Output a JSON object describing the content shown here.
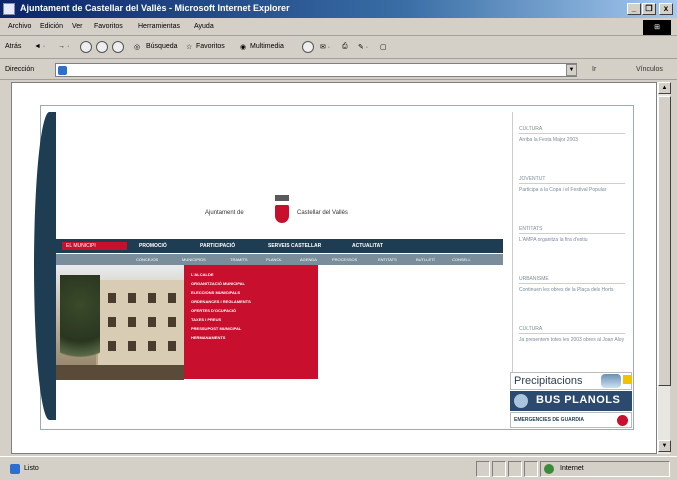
{
  "window": {
    "title": "Ajuntament de Castellar del Vallès - Microsoft Internet Explorer",
    "minimize": "_",
    "maximize": "❐",
    "close": "x"
  },
  "menubar": {
    "items": [
      "Archivo",
      "Edición",
      "Ver",
      "Favoritos",
      "Herramientas",
      "Ayuda"
    ]
  },
  "toolbar": {
    "back": "Atrás",
    "search": "Búsqueda",
    "favorites": "Favoritos",
    "multimedia": "Multimedia"
  },
  "addressbar": {
    "label": "Dirección",
    "value": "",
    "go": "Ir",
    "links": "Vínculos"
  },
  "status": {
    "text": "Listo",
    "zone": "Internet"
  },
  "site": {
    "logo_left": "Ajuntament de",
    "logo_right": "Castellar del Vallès",
    "nav": {
      "selected": "EL MUNICIPI",
      "items": [
        "PROMOCIÓ",
        "PARTICIPACIÓ",
        "SERVEIS CASTELLAR",
        "ACTUALITAT"
      ]
    },
    "subnav": [
      "CONCEJOS",
      "MUNICIPIOS",
      "TRAMITS",
      "PLANOL",
      "AGENDA",
      "PROCESSOS",
      "ENTITATS",
      "BUTLLETÍ",
      "CONSELL"
    ],
    "dropdown": [
      "L'ALCALDE",
      "ORGANITZACIÓ MUNICIPAL",
      "ELECCIONS MUNICIPALS",
      "ORDENANCES I REGLAMENTS",
      "OFERTES D'OCUPACIÓ",
      "TAXES I PREUS",
      "PRESSUPOST MUNICIPAL",
      "HERMANAMENTS"
    ],
    "sidebar": [
      {
        "title": "CULTURA",
        "desc": "Arriba la Festa Major 2003"
      },
      {
        "title": "JOVENTUT",
        "desc": "Participa a la Copa i el Festival Popular"
      },
      {
        "title": "ENTITATS",
        "desc": "L'AMPA organitza la fira d'estiu"
      },
      {
        "title": "URBANISME",
        "desc": "Continuen les obres de la Plaça dels Horts"
      },
      {
        "title": "CULTURA",
        "desc": "Ja presentem totes les 2003 obres al Joan Aloy"
      }
    ],
    "banner_precip": "Precipitacions",
    "banner_bus": "BUS PLANOLS",
    "banner_emer": "EMERGENCIES DE GUARDIA"
  }
}
